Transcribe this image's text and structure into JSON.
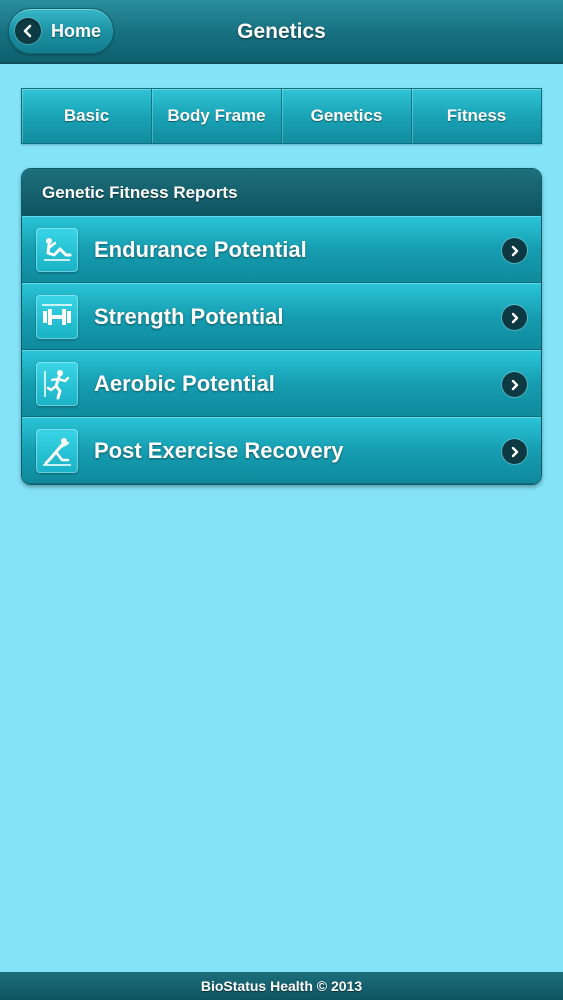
{
  "header": {
    "back_label": "Home",
    "title": "Genetics"
  },
  "tabs": [
    {
      "label": "Basic"
    },
    {
      "label": "Body Frame"
    },
    {
      "label": "Genetics"
    },
    {
      "label": "Fitness"
    }
  ],
  "panel": {
    "title": "Genetic Fitness Reports",
    "items": [
      {
        "label": "Endurance Potential",
        "icon": "situp-icon"
      },
      {
        "label": "Strength Potential",
        "icon": "dumbbell-icon"
      },
      {
        "label": "Aerobic Potential",
        "icon": "runner-icon"
      },
      {
        "label": "Post Exercise Recovery",
        "icon": "stretch-icon"
      }
    ]
  },
  "footer": {
    "text": "BioStatus Health © 2013"
  },
  "colors": {
    "background": "#84e3f8",
    "header": "#167080",
    "accent": "#1aa3b6",
    "chevron": "#0d3a42"
  }
}
